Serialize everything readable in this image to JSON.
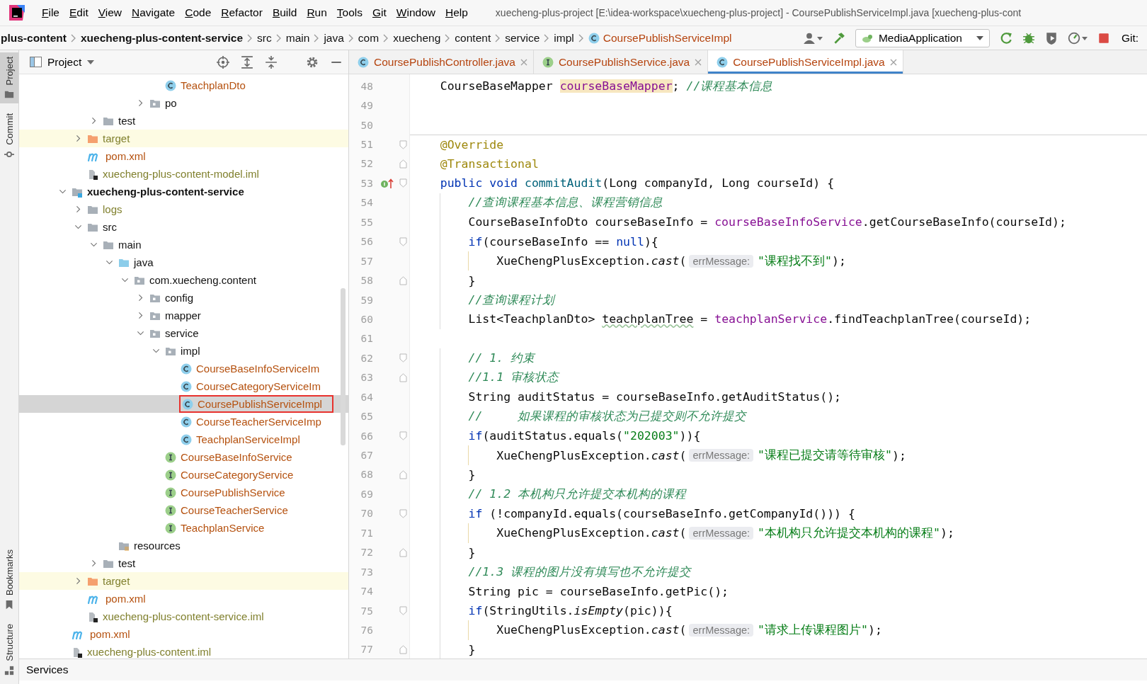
{
  "menu": {
    "items": [
      "File",
      "Edit",
      "View",
      "Navigate",
      "Code",
      "Refactor",
      "Build",
      "Run",
      "Tools",
      "Git",
      "Window",
      "Help"
    ],
    "title": "xuecheng-plus-project [E:\\idea-workspace\\xuecheng-plus-project] - CoursePublishServiceImpl.java [xuecheng-plus-cont"
  },
  "breadcrumbs": [
    {
      "label": "plus-content",
      "kind": "module"
    },
    {
      "label": "xuecheng-plus-content-service",
      "kind": "module"
    },
    {
      "label": "src",
      "kind": "folder"
    },
    {
      "label": "main",
      "kind": "folder"
    },
    {
      "label": "java",
      "kind": "folder"
    },
    {
      "label": "com",
      "kind": "folder"
    },
    {
      "label": "xuecheng",
      "kind": "folder"
    },
    {
      "label": "content",
      "kind": "folder"
    },
    {
      "label": "service",
      "kind": "folder"
    },
    {
      "label": "impl",
      "kind": "folder"
    },
    {
      "label": "CoursePublishServiceImpl",
      "kind": "class"
    }
  ],
  "run_config": {
    "label": "MediaApplication"
  },
  "git_label": "Git:",
  "tool_windows": {
    "top": [
      {
        "label": "Project",
        "kind": "folder",
        "selected": true
      },
      {
        "label": "Commit",
        "kind": "commit",
        "selected": false
      }
    ],
    "bottom": [
      {
        "label": "Bookmarks",
        "kind": "bookmark",
        "selected": false
      },
      {
        "label": "Structure",
        "kind": "structure",
        "selected": false
      }
    ]
  },
  "project_panel": {
    "title": "Project"
  },
  "tree": [
    {
      "children": [
        {
          "children": [
            {
              "children": [
                {
                  "children": [
                    {
                      "children": [
                        {
                          "children": [
                            {
                              "label": "TeachplanDto",
                              "kind": "class",
                              "color": "#b5510f",
                              "selected": false
                            }
                          ]
                        },
                        {
                          "label": "po",
                          "kind": "package",
                          "color": "#111111",
                          "selected": false,
                          "expanded": false
                        }
                      ]
                    }
                  ]
                }
              ]
            },
            {
              "label": "test",
              "kind": "folder",
              "color": "#111111",
              "selected": false,
              "expanded": false
            }
          ]
        },
        {
          "label": "target",
          "kind": "excluded",
          "color": "#80802e",
          "selected": false,
          "expanded": false
        },
        {
          "label": "pom.xml",
          "kind": "maven",
          "color": "#b5510f",
          "selected": false
        },
        {
          "label": "xuecheng-plus-content-model.iml",
          "kind": "iml",
          "color": "#80802e",
          "selected": false
        }
      ]
    },
    {
      "label": "xuecheng-plus-content-service",
      "kind": "module",
      "color": "#111111",
      "selected": false,
      "expanded": true,
      "children": [
        {
          "label": "logs",
          "kind": "folder",
          "color": "#80802e",
          "selected": false,
          "expanded": false
        },
        {
          "label": "src",
          "kind": "folder",
          "color": "#111111",
          "selected": false,
          "expanded": true,
          "children": [
            {
              "label": "main",
              "kind": "folder",
              "color": "#111111",
              "selected": false,
              "expanded": true,
              "children": [
                {
                  "label": "java",
                  "kind": "source",
                  "color": "#111111",
                  "selected": false,
                  "expanded": true,
                  "children": [
                    {
                      "label": "com.xuecheng.content",
                      "kind": "package",
                      "color": "#111111",
                      "selected": false,
                      "expanded": true,
                      "children": [
                        {
                          "label": "config",
                          "kind": "package",
                          "color": "#111111",
                          "selected": false,
                          "expanded": false
                        },
                        {
                          "label": "mapper",
                          "kind": "package",
                          "color": "#111111",
                          "selected": false,
                          "expanded": false
                        },
                        {
                          "label": "service",
                          "kind": "package",
                          "color": "#111111",
                          "selected": false,
                          "expanded": true,
                          "children": [
                            {
                              "label": "impl",
                              "kind": "package",
                              "color": "#111111",
                              "selected": false,
                              "expanded": true,
                              "children": [
                                {
                                  "label": "CourseBaseInfoServiceIm",
                                  "kind": "class",
                                  "color": "#b5510f",
                                  "selected": false
                                },
                                {
                                  "label": "CourseCategoryServiceIm",
                                  "kind": "class",
                                  "color": "#b5510f",
                                  "selected": false
                                },
                                {
                                  "label": "CoursePublishServiceImpl",
                                  "kind": "class",
                                  "color": "#b5510f",
                                  "selected": true
                                },
                                {
                                  "label": "CourseTeacherServiceImp",
                                  "kind": "class",
                                  "color": "#b5510f",
                                  "selected": false
                                },
                                {
                                  "label": "TeachplanServiceImpl",
                                  "kind": "class",
                                  "color": "#b5510f",
                                  "selected": false
                                }
                              ]
                            },
                            {
                              "label": "CourseBaseInfoService",
                              "kind": "interface",
                              "color": "#b5510f",
                              "selected": false
                            },
                            {
                              "label": "CourseCategoryService",
                              "kind": "interface",
                              "color": "#b5510f",
                              "selected": false
                            },
                            {
                              "label": "CoursePublishService",
                              "kind": "interface",
                              "color": "#b5510f",
                              "selected": false
                            },
                            {
                              "label": "CourseTeacherService",
                              "kind": "interface",
                              "color": "#b5510f",
                              "selected": false
                            },
                            {
                              "label": "TeachplanService",
                              "kind": "interface",
                              "color": "#b5510f",
                              "selected": false
                            }
                          ]
                        }
                      ]
                    }
                  ]
                },
                {
                  "label": "resources",
                  "kind": "resources",
                  "color": "#111111",
                  "selected": false
                }
              ]
            },
            {
              "label": "test",
              "kind": "folder",
              "color": "#111111",
              "selected": false,
              "expanded": false
            }
          ]
        },
        {
          "label": "target",
          "kind": "excluded",
          "color": "#80802e",
          "selected": false,
          "expanded": false
        },
        {
          "label": "pom.xml",
          "kind": "maven",
          "color": "#b5510f",
          "selected": false
        },
        {
          "label": "xuecheng-plus-content-service.iml",
          "kind": "iml",
          "color": "#80802e",
          "selected": false
        }
      ]
    },
    {
      "label": "pom.xml",
      "kind": "maven",
      "color": "#b5510f",
      "selected": false
    },
    {
      "label": "xuecheng-plus-content.iml",
      "kind": "iml",
      "color": "#80802e",
      "selected": false
    }
  ],
  "editor_tabs": [
    {
      "label": "CoursePublishController.java",
      "kind": "class",
      "selected": false
    },
    {
      "label": "CoursePublishService.java",
      "kind": "interface",
      "selected": false
    },
    {
      "label": "CoursePublishServiceImpl.java",
      "kind": "class",
      "selected": true
    }
  ],
  "code": [
    {
      "number": "48",
      "tokens": [
        {
          "kind": "plain",
          "text": "    CourseBaseMapper "
        },
        {
          "kind": "highlight",
          "text": "courseBaseMapper"
        },
        {
          "kind": "plain",
          "text": "; "
        },
        {
          "kind": "comment",
          "text": "//课程基本信息"
        }
      ]
    },
    {
      "number": "49"
    },
    {
      "number": "50"
    },
    {
      "number": "51",
      "separator": true,
      "fold": {
        "kind": "start"
      },
      "tokens": [
        {
          "kind": "annotation",
          "text": "    @Override"
        }
      ]
    },
    {
      "number": "52",
      "fold": {
        "kind": "end"
      },
      "tokens": [
        {
          "kind": "annotation",
          "text": "    @Transactional"
        }
      ]
    },
    {
      "number": "53",
      "marker": {
        "kind": "implements"
      },
      "fold": {
        "kind": "start"
      },
      "tokens": [
        {
          "kind": "keyword",
          "text": "    public void "
        },
        {
          "kind": "decl",
          "text": "commitAudit"
        },
        {
          "kind": "plain",
          "text": "(Long companyId, Long courseId) {"
        }
      ]
    },
    {
      "number": "54",
      "tokens": [
        {
          "kind": "comment",
          "text": "        //查询课程基本信息、课程营销信息"
        }
      ]
    },
    {
      "number": "55",
      "tokens": [
        {
          "kind": "plain",
          "text": "        CourseBaseInfoDto courseBaseInfo = "
        },
        {
          "kind": "field",
          "text": "courseBaseInfoService"
        },
        {
          "kind": "plain",
          "text": ".getCourseBaseInfo(courseId);"
        }
      ]
    },
    {
      "number": "56",
      "fold": {
        "kind": "start"
      },
      "tokens": [
        {
          "kind": "keyword",
          "text": "        if"
        },
        {
          "kind": "plain",
          "text": "(courseBaseInfo == "
        },
        {
          "kind": "keyword",
          "text": "null"
        },
        {
          "kind": "plain",
          "text": "){"
        }
      ]
    },
    {
      "number": "57",
      "tokens": [
        {
          "kind": "plain",
          "text": "            XueChengPlusException."
        },
        {
          "kind": "static",
          "text": "cast"
        },
        {
          "kind": "plain",
          "text": "("
        },
        {
          "kind": "hint",
          "text": "errMessage:"
        },
        {
          "kind": "string",
          "text": "\"课程找不到\""
        },
        {
          "kind": "plain",
          "text": ");"
        }
      ]
    },
    {
      "number": "58",
      "fold": {
        "kind": "end"
      },
      "tokens": [
        {
          "kind": "plain",
          "text": "        }"
        }
      ]
    },
    {
      "number": "59",
      "tokens": [
        {
          "kind": "comment",
          "text": "        //查询课程计划"
        }
      ]
    },
    {
      "number": "60",
      "tokens": [
        {
          "kind": "plain",
          "text": "        List<TeachplanDto> "
        },
        {
          "kind": "warn",
          "text": "teachplanTree"
        },
        {
          "kind": "plain",
          "text": " = "
        },
        {
          "kind": "field",
          "text": "teachplanService"
        },
        {
          "kind": "plain",
          "text": ".findTeachplanTree(courseId);"
        }
      ]
    },
    {
      "number": "61"
    },
    {
      "number": "62",
      "fold": {
        "kind": "start"
      },
      "tokens": [
        {
          "kind": "comment",
          "text": "        // 1. 约束"
        }
      ]
    },
    {
      "number": "63",
      "fold": {
        "kind": "end"
      },
      "tokens": [
        {
          "kind": "comment",
          "text": "        //1.1 审核状态"
        }
      ]
    },
    {
      "number": "64",
      "tokens": [
        {
          "kind": "plain",
          "text": "        String auditStatus = courseBaseInfo.getAuditStatus();"
        }
      ]
    },
    {
      "number": "65",
      "tokens": [
        {
          "kind": "comment",
          "text": "        //     如果课程的审核状态为已提交则不允许提交"
        }
      ]
    },
    {
      "number": "66",
      "fold": {
        "kind": "start"
      },
      "tokens": [
        {
          "kind": "keyword",
          "text": "        if"
        },
        {
          "kind": "plain",
          "text": "(auditStatus.equals("
        },
        {
          "kind": "string",
          "text": "\"202003\""
        },
        {
          "kind": "plain",
          "text": ")){"
        }
      ]
    },
    {
      "number": "67",
      "tokens": [
        {
          "kind": "plain",
          "text": "            XueChengPlusException."
        },
        {
          "kind": "static",
          "text": "cast"
        },
        {
          "kind": "plain",
          "text": "("
        },
        {
          "kind": "hint",
          "text": "errMessage:"
        },
        {
          "kind": "string",
          "text": "\"课程已提交请等待审核\""
        },
        {
          "kind": "plain",
          "text": ");"
        }
      ]
    },
    {
      "number": "68",
      "fold": {
        "kind": "end"
      },
      "tokens": [
        {
          "kind": "plain",
          "text": "        }"
        }
      ]
    },
    {
      "number": "69",
      "tokens": [
        {
          "kind": "comment",
          "text": "        // 1.2 本机构只允许提交本机构的课程"
        }
      ]
    },
    {
      "number": "70",
      "fold": {
        "kind": "start"
      },
      "tokens": [
        {
          "kind": "keyword",
          "text": "        if"
        },
        {
          "kind": "plain",
          "text": " (!companyId.equals(courseBaseInfo.getCompanyId())) {"
        }
      ]
    },
    {
      "number": "71",
      "tokens": [
        {
          "kind": "plain",
          "text": "            XueChengPlusException."
        },
        {
          "kind": "static",
          "text": "cast"
        },
        {
          "kind": "plain",
          "text": "("
        },
        {
          "kind": "hint",
          "text": "errMessage:"
        },
        {
          "kind": "string",
          "text": "\"本机构只允许提交本机构的课程\""
        },
        {
          "kind": "plain",
          "text": ");"
        }
      ]
    },
    {
      "number": "72",
      "fold": {
        "kind": "end"
      },
      "tokens": [
        {
          "kind": "plain",
          "text": "        }"
        }
      ]
    },
    {
      "number": "73",
      "tokens": [
        {
          "kind": "comment",
          "text": "        //1.3 课程的图片没有填写也不允许提交"
        }
      ]
    },
    {
      "number": "74",
      "tokens": [
        {
          "kind": "plain",
          "text": "        String pic = courseBaseInfo.getPic();"
        }
      ]
    },
    {
      "number": "75",
      "fold": {
        "kind": "start"
      },
      "tokens": [
        {
          "kind": "keyword",
          "text": "        if"
        },
        {
          "kind": "plain",
          "text": "(StringUtils."
        },
        {
          "kind": "static",
          "text": "isEmpty"
        },
        {
          "kind": "plain",
          "text": "(pic)){"
        }
      ]
    },
    {
      "number": "76",
      "tokens": [
        {
          "kind": "plain",
          "text": "            XueChengPlusException."
        },
        {
          "kind": "static",
          "text": "cast"
        },
        {
          "kind": "plain",
          "text": "("
        },
        {
          "kind": "hint",
          "text": "errMessage:"
        },
        {
          "kind": "string",
          "text": "\"请求上传课程图片\""
        },
        {
          "kind": "plain",
          "text": ");"
        }
      ]
    },
    {
      "number": "77",
      "fold": {
        "kind": "end"
      },
      "tokens": [
        {
          "kind": "plain",
          "text": "        }"
        }
      ]
    }
  ],
  "bottom_bar": {
    "label": "Services"
  }
}
